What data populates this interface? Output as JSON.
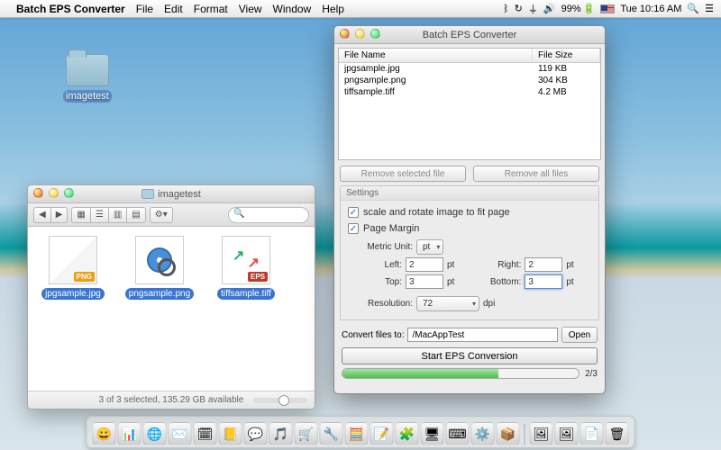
{
  "menubar": {
    "app_name": "Batch EPS Converter",
    "items": [
      "File",
      "Edit",
      "Format",
      "View",
      "Window",
      "Help"
    ],
    "battery": "99%",
    "clock": "Tue 10:16 AM"
  },
  "desktop": {
    "folder_name": "imagetest"
  },
  "finder": {
    "title": "imagetest",
    "files": [
      {
        "name": "jpgsample.jpg",
        "badge": "PNG"
      },
      {
        "name": "pngsample.png",
        "badge": ""
      },
      {
        "name": "tiffsample.tiff",
        "badge": "EPS"
      }
    ],
    "status": "3 of 3 selected, 135.29 GB available"
  },
  "app": {
    "title": "Batch EPS Converter",
    "columns": {
      "name": "File Name",
      "size": "File Size"
    },
    "rows": [
      {
        "name": "jpgsample.jpg",
        "size": "119 KB"
      },
      {
        "name": "pngsample.png",
        "size": "304 KB"
      },
      {
        "name": "tiffsample.tiff",
        "size": "4.2 MB"
      }
    ],
    "remove_selected": "Remove selected file",
    "remove_all": "Remove all files",
    "settings_label": "Settings",
    "scale_rotate": "scale and rotate image to fit page",
    "page_margin": "Page Margin",
    "metric_unit_label": "Metric Unit:",
    "metric_unit_value": "pt",
    "left_label": "Left:",
    "left_val": "2",
    "right_label": "Right:",
    "right_val": "2",
    "top_label": "Top:",
    "top_val": "3",
    "bottom_label": "Bottom:",
    "bottom_val": "3",
    "pt": "pt",
    "resolution_label": "Resolution:",
    "resolution_val": "72",
    "dpi": "dpi",
    "convert_to_label": "Convert files to:",
    "convert_path": "/MacAppTest",
    "open_label": "Open",
    "start_label": "Start EPS Conversion",
    "progress": "2/3"
  },
  "dock": {
    "icons": [
      "😀",
      "📊",
      "🌐",
      "✉️",
      "🗓",
      "📒",
      "💬",
      "🎵",
      "🛒",
      "🔧",
      "🧮",
      "📝",
      "🧩",
      "🖥",
      "⌨",
      "⚙️",
      "📦",
      "🖼",
      "🖼",
      "📄",
      "🗑"
    ]
  }
}
